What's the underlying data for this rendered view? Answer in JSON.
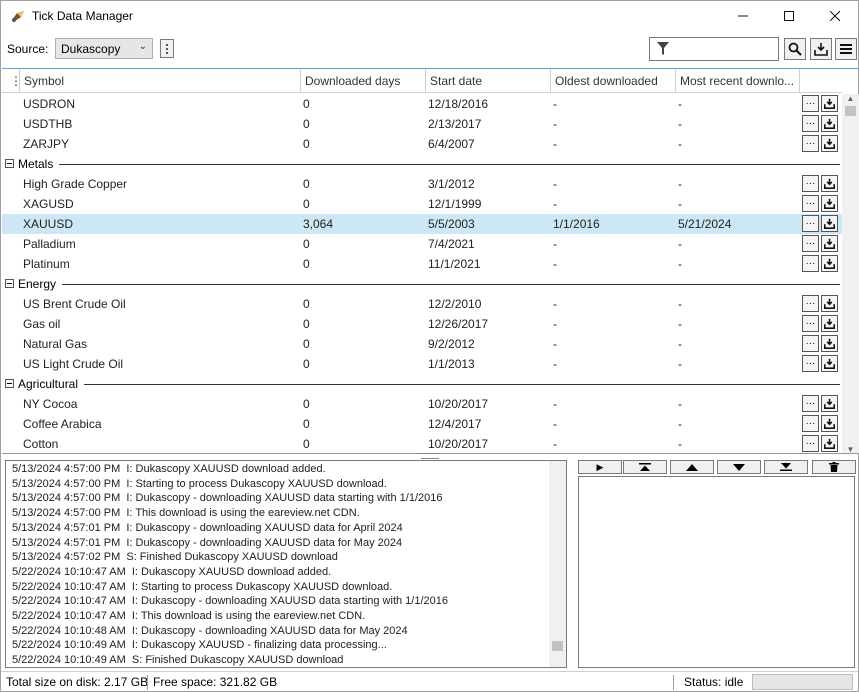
{
  "window": {
    "title": "Tick Data Manager",
    "controls": {
      "minimize": "—",
      "maximize": "☐",
      "close": "✕"
    }
  },
  "toolbar": {
    "source_label": "Source:",
    "source_value": "Dukascopy",
    "filter_placeholder": "",
    "icons": [
      "funnel-icon",
      "search-icon",
      "download-icon",
      "menu-icon"
    ]
  },
  "grid": {
    "columns": [
      "Symbol",
      "Downloaded days",
      "Start date",
      "Oldest downloaded",
      "Most recent downlo..."
    ],
    "rows_top": [
      {
        "symbol": "USDRON",
        "days": "0",
        "start": "12/18/2016",
        "oldest": "-",
        "recent": "-"
      },
      {
        "symbol": "USDTHB",
        "days": "0",
        "start": "2/13/2017",
        "oldest": "-",
        "recent": "-"
      },
      {
        "symbol": "ZARJPY",
        "days": "0",
        "start": "6/4/2007",
        "oldest": "-",
        "recent": "-"
      }
    ],
    "groups": [
      {
        "name": "Metals",
        "rows": [
          {
            "symbol": "High Grade Copper",
            "days": "0",
            "start": "3/1/2012",
            "oldest": "-",
            "recent": "-"
          },
          {
            "symbol": "XAGUSD",
            "days": "0",
            "start": "12/1/1999",
            "oldest": "-",
            "recent": "-"
          },
          {
            "symbol": "XAUUSD",
            "days": "3,064",
            "start": "5/5/2003",
            "oldest": "1/1/2016",
            "recent": "5/21/2024",
            "selected": true
          },
          {
            "symbol": "Palladium",
            "days": "0",
            "start": "7/4/2021",
            "oldest": "-",
            "recent": "-"
          },
          {
            "symbol": "Platinum",
            "days": "0",
            "start": "11/1/2021",
            "oldest": "-",
            "recent": "-"
          }
        ]
      },
      {
        "name": "Energy",
        "rows": [
          {
            "symbol": "US Brent Crude Oil",
            "days": "0",
            "start": "12/2/2010",
            "oldest": "-",
            "recent": "-"
          },
          {
            "symbol": "Gas oil",
            "days": "0",
            "start": "12/26/2017",
            "oldest": "-",
            "recent": "-"
          },
          {
            "symbol": "Natural Gas",
            "days": "0",
            "start": "9/2/2012",
            "oldest": "-",
            "recent": "-"
          },
          {
            "symbol": "US Light Crude Oil",
            "days": "0",
            "start": "1/1/2013",
            "oldest": "-",
            "recent": "-"
          }
        ]
      },
      {
        "name": "Agricultural",
        "rows": [
          {
            "symbol": "NY Cocoa",
            "days": "0",
            "start": "10/20/2017",
            "oldest": "-",
            "recent": "-"
          },
          {
            "symbol": "Coffee Arabica",
            "days": "0",
            "start": "12/4/2017",
            "oldest": "-",
            "recent": "-"
          },
          {
            "symbol": "Cotton",
            "days": "0",
            "start": "10/20/2017",
            "oldest": "-",
            "recent": "-"
          }
        ]
      }
    ],
    "row_button_more": "···"
  },
  "log": {
    "lines": [
      "5/13/2024 4:57:00 PM  I: Dukascopy XAUUSD download added.",
      "5/13/2024 4:57:00 PM  I: Starting to process Dukascopy XAUUSD download.",
      "5/13/2024 4:57:00 PM  I: Dukascopy - downloading XAUUSD data starting with 1/1/2016",
      "5/13/2024 4:57:00 PM  I: This download is using the eareview.net CDN.",
      "5/13/2024 4:57:01 PM  I: Dukascopy - downloading XAUUSD data for April 2024",
      "5/13/2024 4:57:01 PM  I: Dukascopy - downloading XAUUSD data for May 2024",
      "5/13/2024 4:57:02 PM  S: Finished Dukascopy XAUUSD download",
      "5/22/2024 10:10:47 AM  I: Dukascopy XAUUSD download added.",
      "5/22/2024 10:10:47 AM  I: Starting to process Dukascopy XAUUSD download.",
      "5/22/2024 10:10:47 AM  I: Dukascopy - downloading XAUUSD data starting with 1/1/2016",
      "5/22/2024 10:10:47 AM  I: This download is using the eareview.net CDN.",
      "5/22/2024 10:10:48 AM  I: Dukascopy - downloading XAUUSD data for May 2024",
      "5/22/2024 10:10:49 AM  I: Dukascopy XAUUSD - finalizing data processing...",
      "5/22/2024 10:10:49 AM  S: Finished Dukascopy XAUUSD download"
    ]
  },
  "queue": {
    "buttons": [
      "play-icon",
      "move-top-icon",
      "move-up-icon",
      "move-down-icon",
      "move-bottom-icon",
      "trash-icon"
    ],
    "glyphs": [
      "▶",
      "⏶",
      "▲",
      "▼",
      "⏷",
      "🗑"
    ]
  },
  "status": {
    "total_size": "Total size on disk: 2.17 GB",
    "free_space": "Free space: 321.82 GB",
    "state": "Status: idle"
  }
}
